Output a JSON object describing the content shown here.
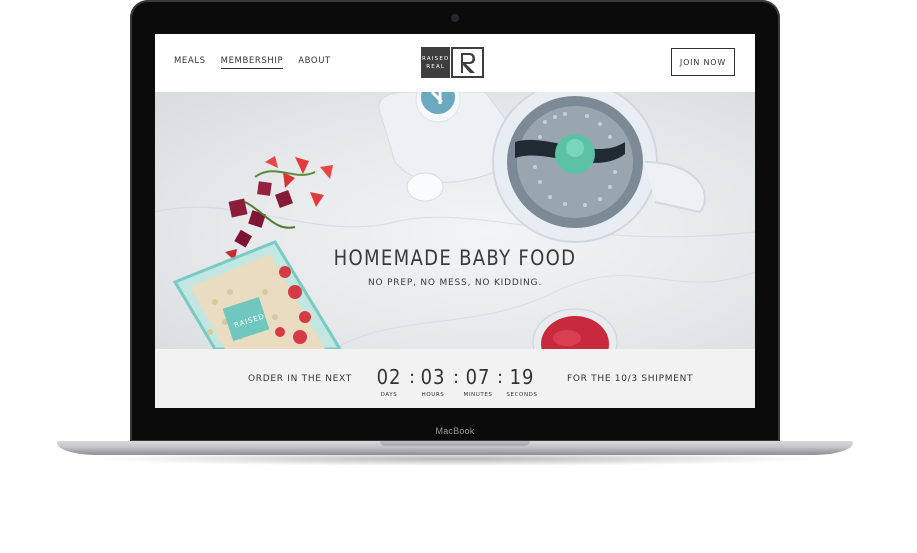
{
  "device": {
    "label": "MacBook"
  },
  "nav": {
    "links": [
      "MEALS",
      "MEMBERSHIP",
      "ABOUT"
    ],
    "active_link": "MEMBERSHIP",
    "logo_top": "RAISED",
    "logo_bottom": "REAL",
    "logo_mark": "R",
    "join_label": "JOIN NOW"
  },
  "hero": {
    "title": "HOMEMADE BABY FOOD",
    "subtitle": "NO PREP, NO MESS, NO KIDDING.",
    "bag_label": "RAISED"
  },
  "countdown": {
    "before_text": "ORDER IN THE NEXT",
    "after_text": "FOR THE 10/3 SHIPMENT",
    "units": [
      {
        "value": "02",
        "label": "DAYS"
      },
      {
        "value": "03",
        "label": "HOURS"
      },
      {
        "value": "07",
        "label": "MINUTES"
      },
      {
        "value": "19",
        "label": "SECONDS"
      }
    ],
    "separator": ":"
  },
  "colors": {
    "accent_teal": "#6fc7c0",
    "brand_dark": "#3e3e3e",
    "strip_bg": "#f2f2f2"
  }
}
